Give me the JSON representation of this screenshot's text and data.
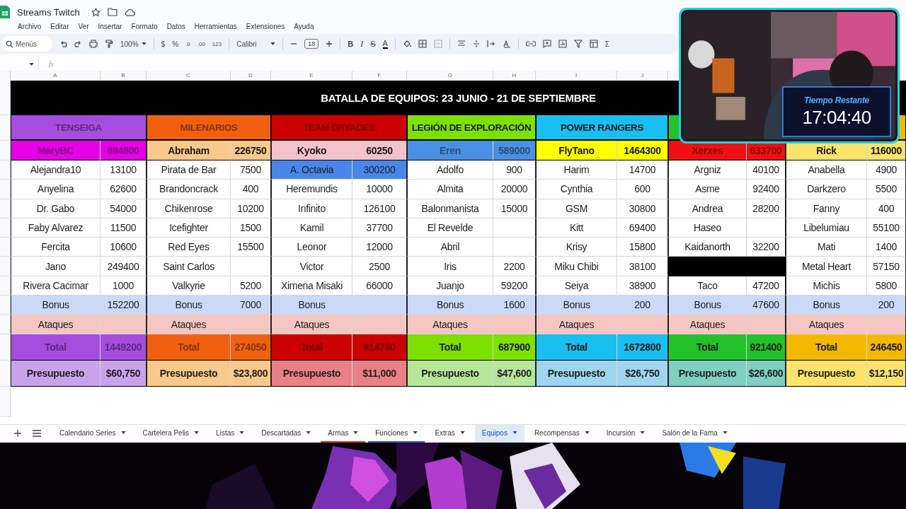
{
  "document": {
    "title": "Streams Twitch"
  },
  "menu": [
    "Archivo",
    "Editar",
    "Ver",
    "Insertar",
    "Formato",
    "Datos",
    "Herramientas",
    "Extensiones",
    "Ayuda"
  ],
  "toolbar": {
    "search_placeholder": "Menús",
    "zoom": "100%",
    "currency": "$",
    "percent": "%",
    "decrease_decimals": ".0",
    "increase_decimals": ".00",
    "number_format": "123",
    "font": "Calibri",
    "font_size": "18",
    "bold": "B",
    "italic": "I",
    "strikethrough": "S",
    "text_color": "A",
    "sum": "Σ"
  },
  "formula_bar": {
    "fx": "fx"
  },
  "columns": [
    "A",
    "B",
    "C",
    "D",
    "E",
    "F",
    "G",
    "H",
    "I",
    "J"
  ],
  "title": "BATALLA DE EQUIPOS: 23 JUNIO - 21 DE SEPTIEMBRE",
  "teams": [
    {
      "name": "TENSEIGA",
      "color": "#a64de0",
      "leader": {
        "name": "MaryBC",
        "points": "894800",
        "color": "#e600e6"
      },
      "members": [
        {
          "kind": "player",
          "name": "Alejandra10",
          "points": "13100"
        },
        {
          "kind": "player",
          "name": "Anyelina",
          "points": "62600"
        },
        {
          "kind": "player",
          "name": "Dr. Gabo",
          "points": "54000"
        },
        {
          "kind": "player",
          "name": "Faby Alvarez",
          "points": "11500"
        },
        {
          "kind": "player",
          "name": "Fercita",
          "points": "10600"
        },
        {
          "kind": "player",
          "name": "Jano",
          "points": "249400"
        },
        {
          "kind": "player",
          "name": "Rivera Cacimar",
          "points": "1000"
        }
      ],
      "bonus": {
        "label": "Bonus",
        "points": "152200"
      },
      "attacks": {
        "label": "Ataques"
      },
      "total": {
        "label": "Total",
        "points": "1449200"
      },
      "budget": {
        "label": "Presupuesto",
        "amount": "$60,750",
        "color": "#c9a3ea"
      }
    },
    {
      "name": "MILENARIOS",
      "color": "#f0600f",
      "leader": {
        "name": "Abraham",
        "points": "226750",
        "color": "#f9c98c"
      },
      "members": [
        {
          "kind": "player",
          "name": "Pirata de Bar",
          "points": "7500"
        },
        {
          "kind": "player",
          "name": "Brandoncrack",
          "points": "400"
        },
        {
          "kind": "player",
          "name": "Chikenrose",
          "points": "10200"
        },
        {
          "kind": "player",
          "name": "Icefighter",
          "points": "1500"
        },
        {
          "kind": "player",
          "name": "Red Eyes",
          "points": "15500"
        },
        {
          "kind": "player",
          "name": "Saint Carlos"
        },
        {
          "kind": "player",
          "name": "Valkyrie",
          "points": "5200"
        }
      ],
      "bonus": {
        "label": "Bonus",
        "points": "7000"
      },
      "attacks": {
        "label": "Ataques"
      },
      "total": {
        "label": "Total",
        "points": "274050"
      },
      "budget": {
        "label": "Presupuesto",
        "amount": "$23,800",
        "color": "#f9c98c"
      }
    },
    {
      "name": "TEAM DRYADES",
      "color": "#cc0000",
      "leader": {
        "name": "Kyoko",
        "points": "60250",
        "color": "#f4c3c9"
      },
      "members": [
        {
          "kind": "player",
          "name": "A. Octavia",
          "points": "300200",
          "color": "#4a86e8"
        },
        {
          "kind": "player",
          "name": "Heremundis",
          "points": "10000"
        },
        {
          "kind": "player",
          "name": "Infinito",
          "points": "126100"
        },
        {
          "kind": "player",
          "name": "Kamil",
          "points": "37700"
        },
        {
          "kind": "player",
          "name": "Leonor",
          "points": "12000"
        },
        {
          "kind": "player",
          "name": "Victor",
          "points": "2500"
        },
        {
          "kind": "player",
          "name": "Ximena Misaki",
          "points": "66000"
        }
      ],
      "bonus": {
        "label": "Bonus"
      },
      "attacks": {
        "label": "Ataques"
      },
      "total": {
        "label": "Total",
        "points": "614750"
      },
      "budget": {
        "label": "Presupuesto",
        "amount": "$11,000",
        "color": "#ea8087"
      }
    },
    {
      "name": "LEGIÓN DE EXPLORACIÓN",
      "color": "#7ee000",
      "leader": {
        "name": "Eren",
        "points": "589000",
        "color": "#4a90e2"
      },
      "members": [
        {
          "kind": "player",
          "name": "Adolfo",
          "points": "900"
        },
        {
          "kind": "player",
          "name": "Almita",
          "points": "20000"
        },
        {
          "kind": "player",
          "name": "Balonmanista",
          "points": "15000"
        },
        {
          "kind": "player",
          "name": "El Revelde"
        },
        {
          "kind": "player",
          "name": "Abril"
        },
        {
          "kind": "player",
          "name": "Iris",
          "points": "2200"
        },
        {
          "kind": "player",
          "name": "Juanjo",
          "points": "59200"
        }
      ],
      "bonus": {
        "label": "Bonus",
        "points": "1600"
      },
      "attacks": {
        "label": "Ataques"
      },
      "total": {
        "label": "Total",
        "points": "687900"
      },
      "budget": {
        "label": "Presupuesto",
        "amount": "$47,600",
        "color": "#b5e69b"
      }
    },
    {
      "name": "POWER RANGERS",
      "color": "#19bff0",
      "leader": {
        "name": "FlyTano",
        "points": "1464300",
        "color": "#ffff00"
      },
      "members": [
        {
          "kind": "player",
          "name": "Harim",
          "points": "14700"
        },
        {
          "kind": "player",
          "name": "Cynthia",
          "points": "600"
        },
        {
          "kind": "player",
          "name": "GSM",
          "points": "30800"
        },
        {
          "kind": "player",
          "name": "Kitt",
          "points": "69400"
        },
        {
          "kind": "player",
          "name": "Krisy",
          "points": "15800"
        },
        {
          "kind": "player",
          "name": "Miku Chibi",
          "points": "38100"
        },
        {
          "kind": "player",
          "name": "Seiya",
          "points": "38900"
        }
      ],
      "bonus": {
        "label": "Bonus",
        "points": "200"
      },
      "attacks": {
        "label": "Ataques"
      },
      "total": {
        "label": "Total",
        "points": "1672800"
      },
      "budget": {
        "label": "Presupuesto",
        "amount": "$26,750",
        "color": "#9fd5ef"
      }
    },
    {
      "color": "#22c22a",
      "leader": {
        "name": "Xerxes",
        "points": "633700",
        "color": "#ee1111"
      },
      "members": [
        {
          "kind": "player",
          "name": "Argniz",
          "points": "40100"
        },
        {
          "kind": "player",
          "name": "Asme",
          "points": "92400"
        },
        {
          "kind": "player",
          "name": "Andrea",
          "points": "28200"
        },
        {
          "kind": "player",
          "name": "Haseo"
        },
        {
          "kind": "player",
          "name": "Kaidanorth",
          "points": "32200"
        },
        {
          "kind": "blocked"
        },
        {
          "kind": "player",
          "name": "Taco",
          "points": "47200"
        }
      ],
      "bonus": {
        "label": "Bonus",
        "points": "47600"
      },
      "attacks": {
        "label": "Ataques"
      },
      "total": {
        "label": "Total",
        "points": "921400"
      },
      "budget": {
        "label": "Presupuesto",
        "amount": "$26,600",
        "color": "#7fcfc2"
      }
    },
    {
      "color": "#f5b800",
      "leader": {
        "name": "Rick",
        "points": "116000",
        "color": "#fbe36c"
      },
      "members": [
        {
          "kind": "player",
          "name": "Anabella",
          "points": "4900"
        },
        {
          "kind": "player",
          "name": "Darkzero",
          "points": "5500"
        },
        {
          "kind": "player",
          "name": "Fanny",
          "points": "400"
        },
        {
          "kind": "player",
          "name": "Libelumiau",
          "points": "55100"
        },
        {
          "kind": "player",
          "name": "Mati",
          "points": "1400"
        },
        {
          "kind": "player",
          "name": "Metal Heart",
          "points": "57150"
        },
        {
          "kind": "player",
          "name": "Michis",
          "points": "5800"
        }
      ],
      "bonus": {
        "label": "Bonus",
        "points": "200"
      },
      "attacks": {
        "label": "Ataques"
      },
      "total": {
        "label": "Total",
        "points": "246450"
      },
      "budget": {
        "label": "Presupuesto",
        "amount": "$12,150",
        "color": "#fbe36c"
      }
    }
  ],
  "sheet_tabs": [
    {
      "label": "Calendario Series",
      "selected": false
    },
    {
      "label": "Cartelera Pelis",
      "selected": false
    },
    {
      "label": "Listas",
      "selected": false
    },
    {
      "label": "Descartadas",
      "selected": false
    },
    {
      "label": "Armas",
      "selected": false,
      "color": "#e53935"
    },
    {
      "label": "Funciones",
      "selected": false,
      "color": "#3b5bdb"
    },
    {
      "label": "Extras",
      "selected": false
    },
    {
      "label": "Equipos",
      "selected": true
    },
    {
      "label": "Recompensas",
      "selected": false
    },
    {
      "label": "Incursión",
      "selected": false
    },
    {
      "label": "Salón de la Fama",
      "selected": false
    }
  ],
  "timer": {
    "label": "Tiempo Restante",
    "value": "17:04:40"
  }
}
